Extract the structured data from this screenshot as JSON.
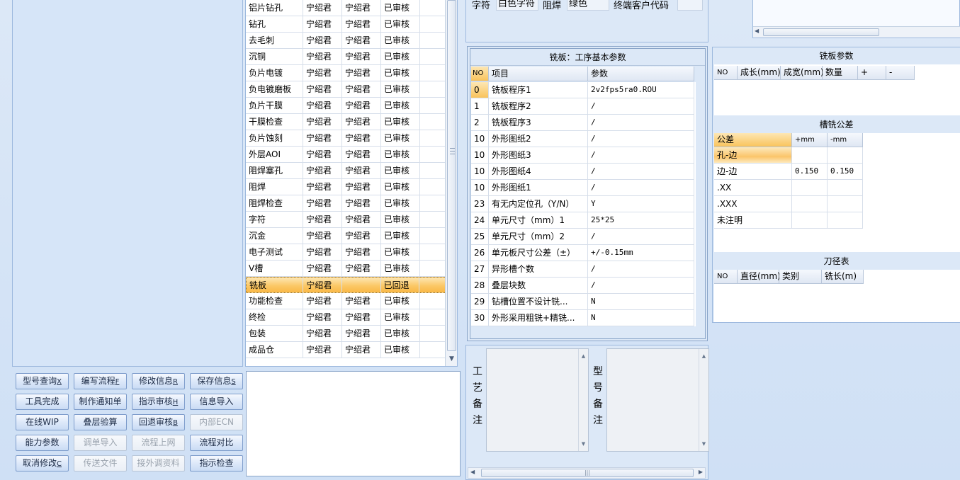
{
  "process_list": {
    "partial_top_row": [
      "",
      "宁绍君",
      "宁绍君",
      "已审核"
    ],
    "rows": [
      [
        "铝片钻孔",
        "宁绍君",
        "宁绍君",
        "已审核"
      ],
      [
        "钻孔",
        "宁绍君",
        "宁绍君",
        "已审核"
      ],
      [
        "去毛刺",
        "宁绍君",
        "宁绍君",
        "已审核"
      ],
      [
        "沉铜",
        "宁绍君",
        "宁绍君",
        "已审核"
      ],
      [
        "负片电镀",
        "宁绍君",
        "宁绍君",
        "已审核"
      ],
      [
        "负电镀磨板",
        "宁绍君",
        "宁绍君",
        "已审核"
      ],
      [
        "负片干膜",
        "宁绍君",
        "宁绍君",
        "已审核"
      ],
      [
        "干膜检查",
        "宁绍君",
        "宁绍君",
        "已审核"
      ],
      [
        "负片蚀刻",
        "宁绍君",
        "宁绍君",
        "已审核"
      ],
      [
        "外层AOI",
        "宁绍君",
        "宁绍君",
        "已审核"
      ],
      [
        "阻焊塞孔",
        "宁绍君",
        "宁绍君",
        "已审核"
      ],
      [
        "阻焊",
        "宁绍君",
        "宁绍君",
        "已审核"
      ],
      [
        "阻焊检查",
        "宁绍君",
        "宁绍君",
        "已审核"
      ],
      [
        "字符",
        "宁绍君",
        "宁绍君",
        "已审核"
      ],
      [
        "沉金",
        "宁绍君",
        "宁绍君",
        "已审核"
      ],
      [
        "电子测试",
        "宁绍君",
        "宁绍君",
        "已审核"
      ],
      [
        "V槽",
        "宁绍君",
        "宁绍君",
        "已审核"
      ],
      [
        "铣板",
        "宁绍君",
        "",
        "已回退"
      ],
      [
        "功能检查",
        "宁绍君",
        "宁绍君",
        "已审核"
      ],
      [
        "终检",
        "宁绍君",
        "宁绍君",
        "已审核"
      ],
      [
        "包装",
        "宁绍君",
        "宁绍君",
        "已审核"
      ],
      [
        "成品仓",
        "宁绍君",
        "宁绍君",
        "已审核"
      ]
    ],
    "selected_index": 17
  },
  "buttons": [
    {
      "label": "型号查询",
      "key": "X",
      "enabled": true
    },
    {
      "label": "编写流程",
      "key": "F",
      "enabled": true
    },
    {
      "label": "修改信息",
      "key": "R",
      "enabled": true
    },
    {
      "label": "保存信息",
      "key": "S",
      "enabled": true
    },
    {
      "label": "工具完成",
      "key": "",
      "enabled": true
    },
    {
      "label": "制作通知单",
      "key": "",
      "enabled": true
    },
    {
      "label": "指示审核",
      "key": "H",
      "enabled": true
    },
    {
      "label": "信息导入",
      "key": "",
      "enabled": true
    },
    {
      "label": "在线WIP",
      "key": "",
      "enabled": true
    },
    {
      "label": "叠层验算",
      "key": "",
      "enabled": true
    },
    {
      "label": "回退审核",
      "key": "B",
      "enabled": true
    },
    {
      "label": "内部ECN",
      "key": "",
      "enabled": false
    },
    {
      "label": "能力参数",
      "key": "",
      "enabled": true
    },
    {
      "label": "调单导入",
      "key": "",
      "enabled": false
    },
    {
      "label": "流程上网",
      "key": "",
      "enabled": false
    },
    {
      "label": "流程对比",
      "key": "",
      "enabled": true
    },
    {
      "label": "取消修改",
      "key": "C",
      "enabled": true
    },
    {
      "label": "传送文件",
      "key": "",
      "enabled": false
    },
    {
      "label": "接外调资料",
      "key": "",
      "enabled": false
    },
    {
      "label": "指示检查",
      "key": "",
      "enabled": true
    }
  ],
  "top_info": {
    "char_label": "字符",
    "char_value": "白色字符",
    "mask_label": "阻焊",
    "mask_value": "绿色",
    "customer_code_label": "终端客户代码",
    "customer_code_value": ""
  },
  "params": {
    "title": "铣板：工序基本参数",
    "headers": {
      "no": "NO",
      "item": "项目",
      "value": "参数"
    },
    "rows": [
      [
        "0",
        "铣板程序1",
        "2v2fps5ra0.ROU"
      ],
      [
        "1",
        "铣板程序2",
        "/"
      ],
      [
        "2",
        "铣板程序3",
        "/"
      ],
      [
        "10",
        "外形图纸2",
        "/"
      ],
      [
        "10",
        "外形图纸3",
        "/"
      ],
      [
        "10",
        "外形图纸4",
        "/"
      ],
      [
        "10",
        "外形图纸1",
        "/"
      ],
      [
        "23",
        "有无内定位孔（Y/N）",
        "Y"
      ],
      [
        "24",
        "单元尺寸（mm）1",
        "25*25"
      ],
      [
        "25",
        "单元尺寸（mm）2",
        "/"
      ],
      [
        "26",
        "单元板尺寸公差（±）",
        "+/-0.15mm"
      ],
      [
        "27",
        "异形槽个数",
        "/"
      ],
      [
        "28",
        "叠层块数",
        "/"
      ],
      [
        "29",
        "钻槽位置不设计铣...",
        "N"
      ],
      [
        "30",
        "外形采用粗铣+精铣...",
        "N"
      ]
    ]
  },
  "remarks": {
    "process_label": [
      "工",
      "艺",
      "备",
      "注"
    ],
    "model_label": [
      "型",
      "号",
      "备",
      "注"
    ]
  },
  "mill_params": {
    "title": "铣板参数",
    "headers": [
      "NO",
      "成长(mm)",
      "成宽(mm)",
      "数量",
      "+",
      "-"
    ]
  },
  "slot_tolerance": {
    "title": "槽铣公差",
    "headers": [
      "公差",
      "+mm",
      "-mm"
    ],
    "rows": [
      [
        "孔-边",
        "",
        ""
      ],
      [
        "边-边",
        "0.150",
        "0.150"
      ],
      [
        ".XX",
        "",
        ""
      ],
      [
        ".XXX",
        "",
        ""
      ],
      [
        "未注明",
        "",
        ""
      ]
    ]
  },
  "tool_table": {
    "title": "刀径表",
    "headers": [
      "NO",
      "直径(mm)",
      "类别",
      "铣长(m)"
    ]
  },
  "colors": {
    "selection": "#f9b846",
    "panel_bg": "#dce8f7",
    "border": "#9db9de"
  }
}
